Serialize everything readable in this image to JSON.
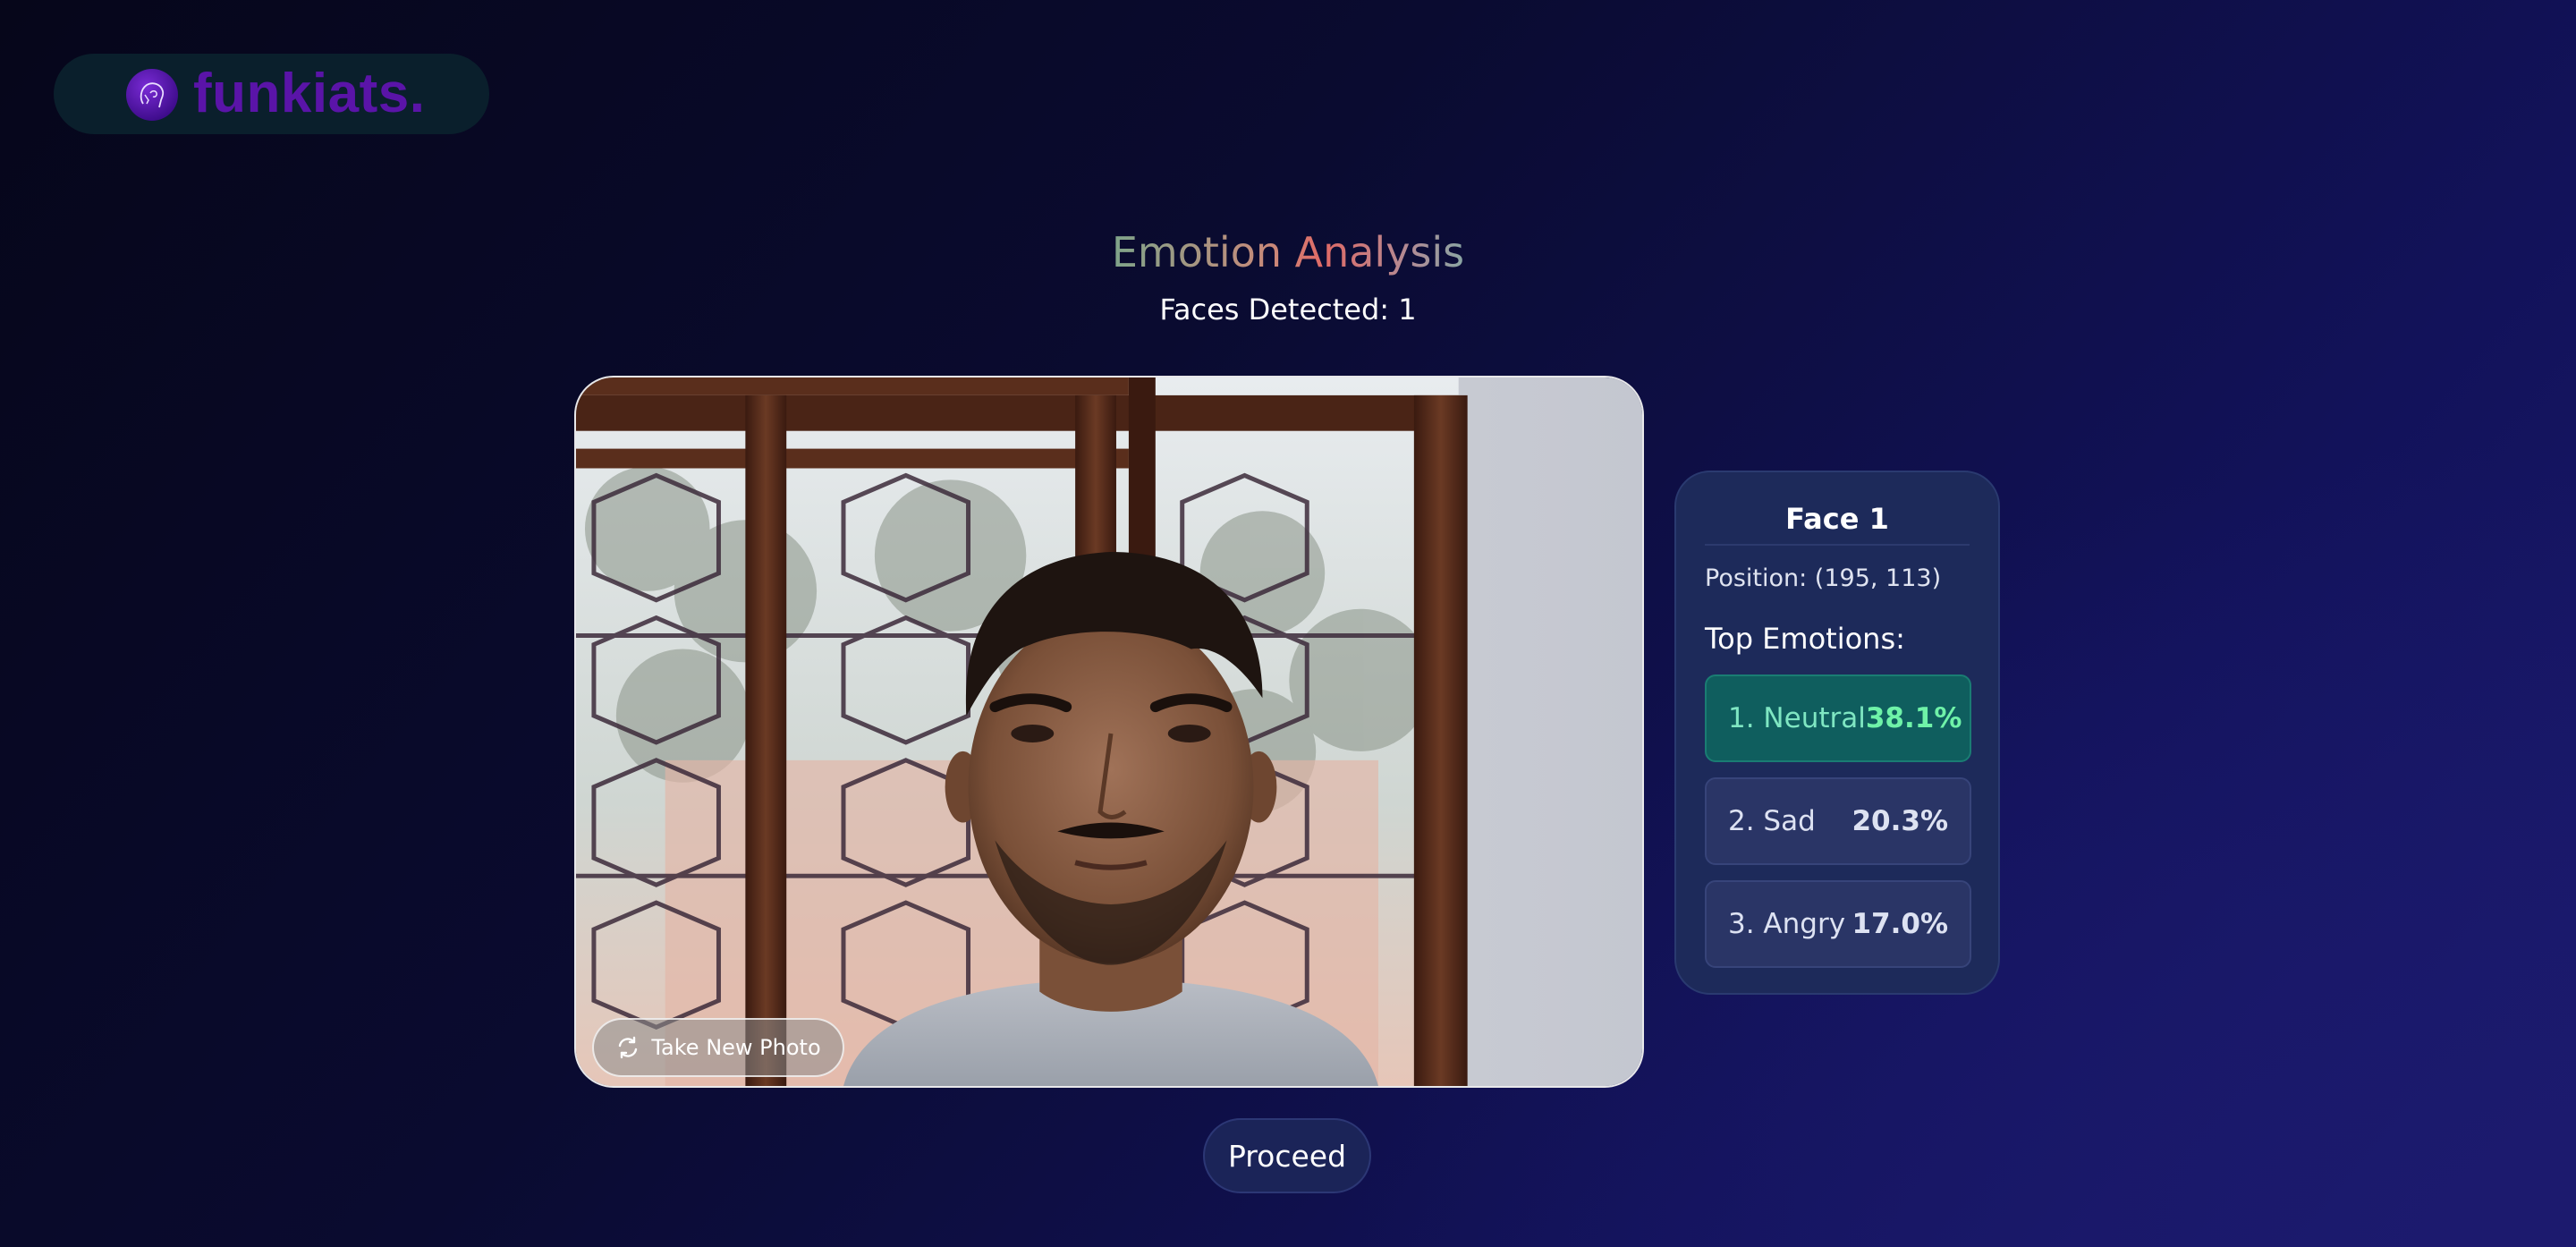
{
  "brand": {
    "name": "funkiats.",
    "logo_icon": "face-silhouette-icon"
  },
  "header": {
    "title": "Emotion Analysis",
    "faces_detected": "Faces Detected: 1"
  },
  "photo": {
    "retake_label": "Take New Photo",
    "retake_icon": "refresh-icon"
  },
  "results": {
    "face_title": "Face 1",
    "position": "Position: (195, 113)",
    "top_emotions_label": "Top Emotions:",
    "emotions": [
      {
        "name": "1. Neutral",
        "percent": "38.1%"
      },
      {
        "name": "2. Sad",
        "percent": "20.3%"
      },
      {
        "name": "3. Angry",
        "percent": "17.0%"
      }
    ]
  },
  "actions": {
    "proceed_label": "Proceed"
  },
  "colors": {
    "background_dark": "#06061a",
    "background_light": "#1a1a6e",
    "card": "#1d2a5a",
    "top_emotion_bg": "#0f5e5e",
    "top_emotion_text": "#6ff2a8",
    "brand": "#5a14a8"
  }
}
